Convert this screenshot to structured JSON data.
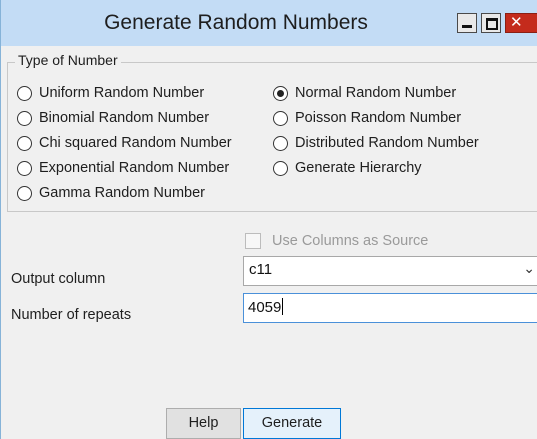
{
  "window": {
    "title": "Generate Random Numbers"
  },
  "type_of_number": {
    "legend": "Type of Number",
    "options": [
      {
        "label": "Uniform Random Number",
        "checked": false
      },
      {
        "label": "Binomial Random Number",
        "checked": false
      },
      {
        "label": "Chi squared Random Number",
        "checked": false
      },
      {
        "label": "Exponential Random Number",
        "checked": false
      },
      {
        "label": "Gamma Random Number",
        "checked": false
      },
      {
        "label": "Normal Random Number",
        "checked": true
      },
      {
        "label": "Poisson Random Number",
        "checked": false
      },
      {
        "label": "Distributed Random Number",
        "checked": false
      },
      {
        "label": "Generate Hierarchy",
        "checked": false
      }
    ]
  },
  "use_columns": {
    "label": "Use Columns as Source",
    "checked": false,
    "enabled": false
  },
  "output_column": {
    "label": "Output column",
    "value": "c11"
  },
  "repeats": {
    "label": "Number of repeats",
    "value": "4059"
  },
  "buttons": {
    "help": "Help",
    "generate": "Generate"
  }
}
